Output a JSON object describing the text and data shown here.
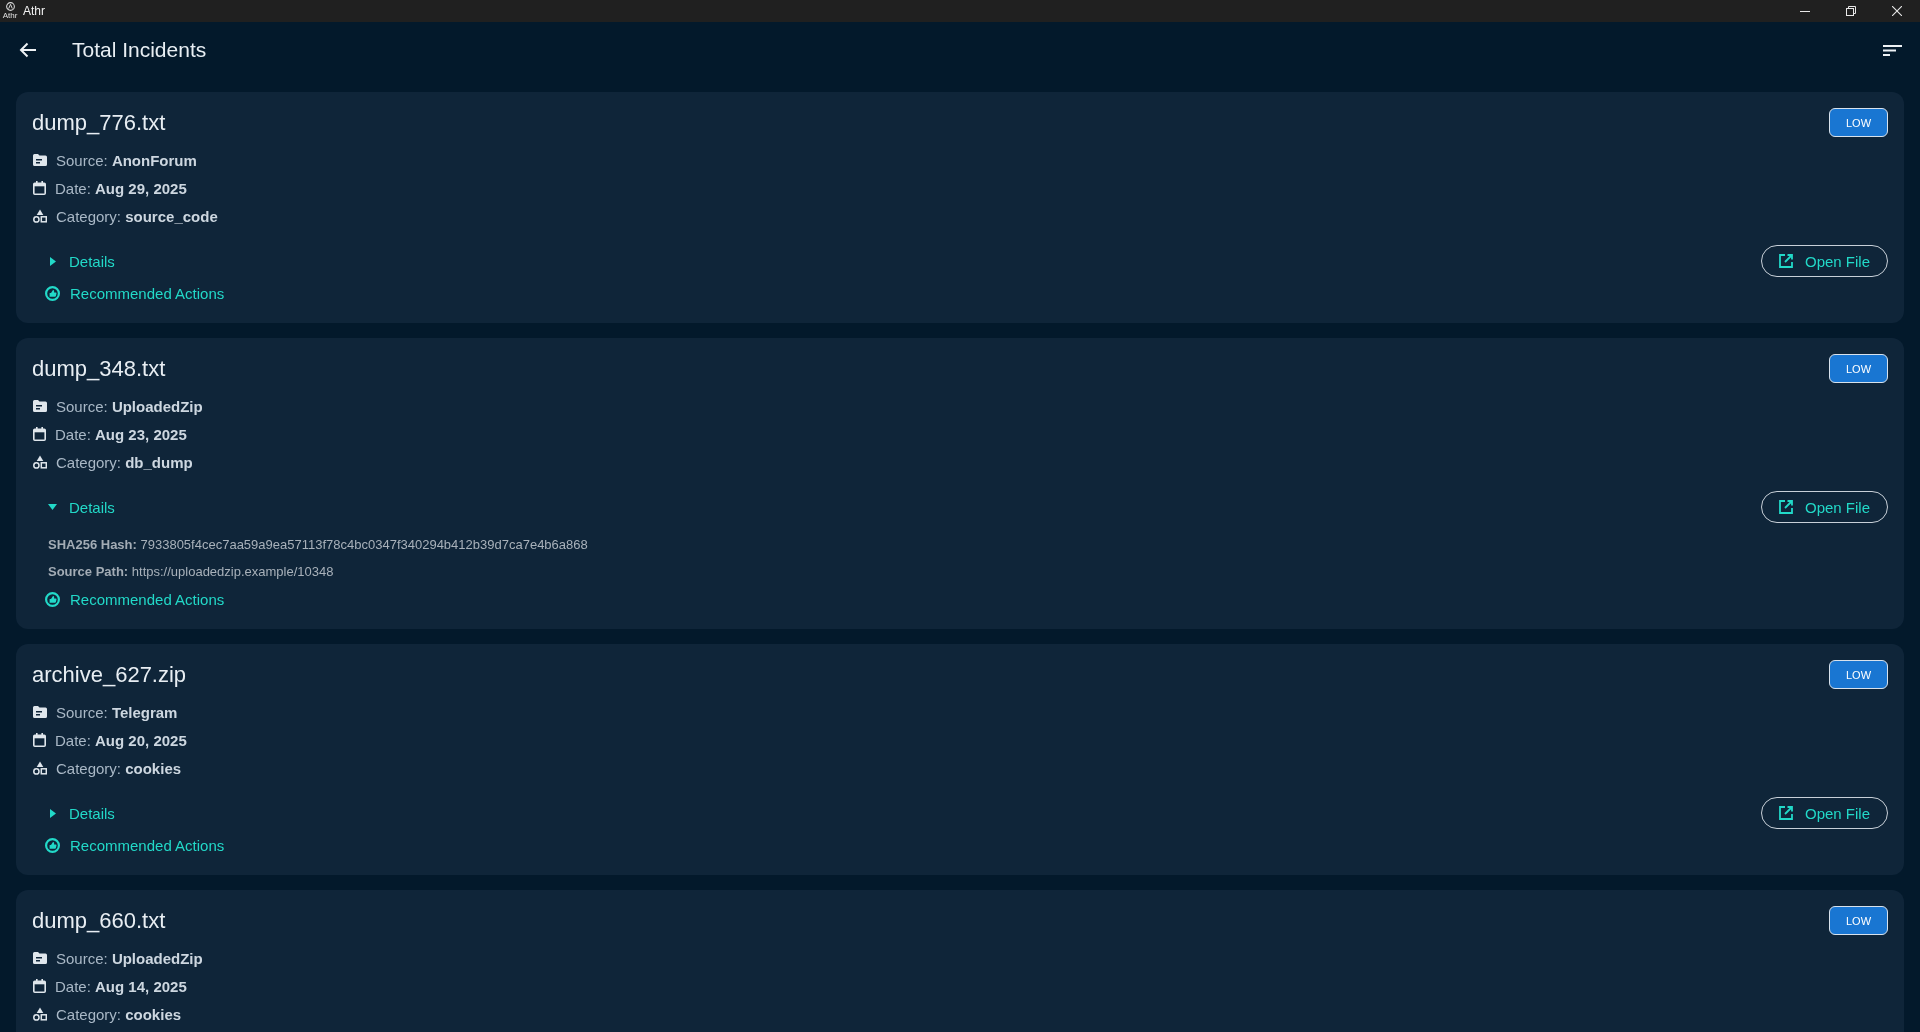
{
  "window": {
    "title": "Athr",
    "logo_caption": "Athr"
  },
  "header": {
    "title": "Total Incidents"
  },
  "incidents": [
    {
      "name": "dump_776.txt",
      "severity": "LOW",
      "fields": [
        {
          "kind": "source",
          "label": "Source:",
          "value": "AnonForum"
        },
        {
          "kind": "date",
          "label": "Date:",
          "value": "Aug 29, 2025"
        },
        {
          "kind": "category",
          "label": "Category:",
          "value": "source_code"
        }
      ],
      "details": {
        "label": "Details",
        "expanded": false
      },
      "actions_label": "Recommended Actions",
      "open_button": "Open File"
    },
    {
      "name": "dump_348.txt",
      "severity": "LOW",
      "fields": [
        {
          "kind": "source",
          "label": "Source:",
          "value": "UploadedZip"
        },
        {
          "kind": "date",
          "label": "Date:",
          "value": "Aug 23, 2025"
        },
        {
          "kind": "category",
          "label": "Category:",
          "value": "db_dump"
        }
      ],
      "details": {
        "label": "Details",
        "expanded": true,
        "rows": [
          {
            "label": "SHA256 Hash:",
            "value": "7933805f4cec7aa59a9ea57113f78c4bc0347f340294b412b39d7ca7e4b6a868"
          },
          {
            "label": "Source Path:",
            "value": "https://uploadedzip.example/10348"
          }
        ]
      },
      "actions_label": "Recommended Actions",
      "open_button": "Open File"
    },
    {
      "name": "archive_627.zip",
      "severity": "LOW",
      "fields": [
        {
          "kind": "source",
          "label": "Source:",
          "value": "Telegram"
        },
        {
          "kind": "date",
          "label": "Date:",
          "value": "Aug 20, 2025"
        },
        {
          "kind": "category",
          "label": "Category:",
          "value": "cookies"
        }
      ],
      "details": {
        "label": "Details",
        "expanded": false
      },
      "actions_label": "Recommended Actions",
      "open_button": "Open File"
    },
    {
      "name": "dump_660.txt",
      "severity": "LOW",
      "fields": [
        {
          "kind": "source",
          "label": "Source:",
          "value": "UploadedZip"
        },
        {
          "kind": "date",
          "label": "Date:",
          "value": "Aug 14, 2025"
        },
        {
          "kind": "category",
          "label": "Category:",
          "value": "cookies"
        }
      ]
    }
  ]
}
